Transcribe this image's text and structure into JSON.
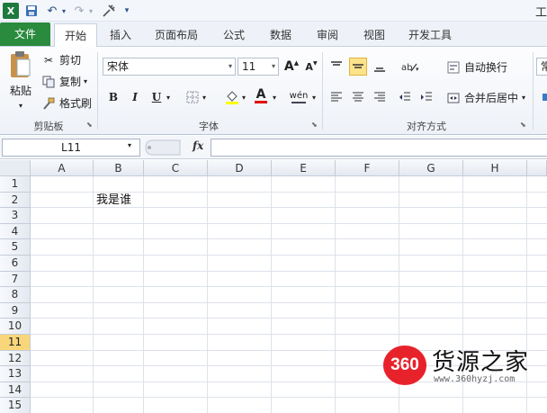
{
  "window": {
    "title": "工"
  },
  "qat": {
    "app_icon": "X",
    "save_icon": "floppy-icon",
    "undo_icon": "↶",
    "redo_icon": "↷",
    "customize_icon": "▾"
  },
  "tabs": [
    "文件",
    "开始",
    "插入",
    "页面布局",
    "公式",
    "数据",
    "审阅",
    "视图",
    "开发工具"
  ],
  "clipboard": {
    "paste_label": "粘贴",
    "cut_label": "剪切",
    "copy_label": "复制",
    "format_painter_label": "格式刷",
    "group_label": "剪贴板"
  },
  "font": {
    "font_name": "宋体",
    "font_size": "11",
    "bold": "B",
    "italic": "I",
    "underline": "U",
    "grow": "A",
    "shrink": "A",
    "font_color_glyph": "A",
    "phonetic": "wén",
    "group_label": "字体"
  },
  "alignment": {
    "wrap_text_label": "自动换行",
    "merge_center_label": "合并后居中",
    "group_label": "对齐方式"
  },
  "number": {
    "format_cutoff": "常"
  },
  "formula_bar": {
    "name_box": "L11",
    "fx_label": "fx",
    "formula": ""
  },
  "grid": {
    "columns": [
      "A",
      "B",
      "C",
      "D",
      "E",
      "F",
      "G",
      "H"
    ],
    "rows": [
      "1",
      "2",
      "3",
      "4",
      "5",
      "6",
      "7",
      "8",
      "9",
      "10",
      "11",
      "12",
      "13",
      "14",
      "15"
    ],
    "selected_row": "11",
    "cells": [
      {
        "ref": "B2",
        "value": "我是谁"
      }
    ]
  },
  "watermark": {
    "badge": "360",
    "title": "货源之家",
    "url": "www.360hyzj.com"
  },
  "colors": {
    "file_tab": "#2a8a3e",
    "active_button": "#fde38a",
    "selected_header": "#f9d67a",
    "watermark_red": "#e8222b"
  }
}
